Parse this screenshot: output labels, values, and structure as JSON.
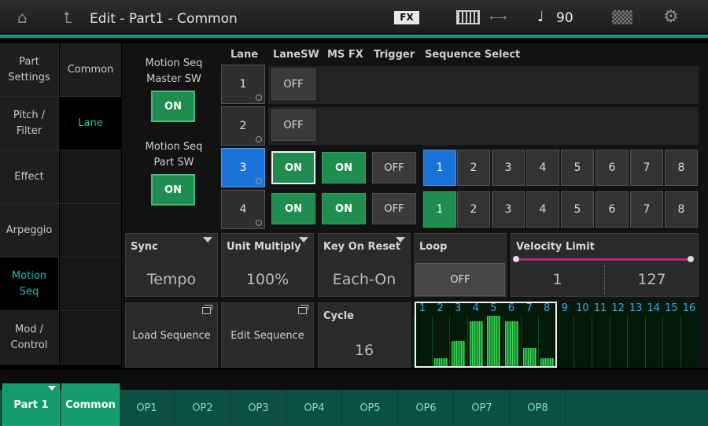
{
  "header": {
    "title": "Edit - Part1 - Common",
    "fx_badge": "FX",
    "tempo": "90"
  },
  "nav_primary": [
    {
      "label": "Part\nSettings",
      "active": false
    },
    {
      "label": "Pitch /\nFilter",
      "active": false
    },
    {
      "label": "Effect",
      "active": false
    },
    {
      "label": "Arpeggio",
      "active": false
    },
    {
      "label": "Motion\nSeq",
      "active": true
    },
    {
      "label": "Mod /\nControl",
      "active": false
    }
  ],
  "nav_secondary": [
    {
      "label": "Common",
      "active": false
    },
    {
      "label": "Lane",
      "active": true
    }
  ],
  "master_sw": {
    "label": "Motion Seq\nMaster SW",
    "value": "ON"
  },
  "part_sw": {
    "label": "Motion Seq\nPart SW",
    "value": "ON"
  },
  "columns": {
    "lane": "Lane",
    "lanesw": "LaneSW",
    "msfx": "MS FX",
    "trigger": "Trigger",
    "seq_select": "Sequence Select"
  },
  "lanes": [
    {
      "num": "1",
      "active": false,
      "lanesw": "OFF"
    },
    {
      "num": "2",
      "active": false,
      "lanesw": "OFF"
    },
    {
      "num": "3",
      "active": true,
      "lanesw": "ON",
      "msfx": "ON",
      "trigger": "OFF",
      "sequences": [
        "1",
        "2",
        "3",
        "4",
        "5",
        "6",
        "7",
        "8"
      ],
      "selected": "1",
      "color": "blue"
    },
    {
      "num": "4",
      "active": false,
      "lanesw": "ON",
      "msfx": "ON",
      "trigger": "OFF",
      "sequences": [
        "1",
        "2",
        "3",
        "4",
        "5",
        "6",
        "7",
        "8"
      ],
      "selected": "1",
      "color": "green"
    }
  ],
  "params": {
    "sync": {
      "label": "Sync",
      "value": "Tempo"
    },
    "unit_multiply": {
      "label": "Unit Multiply",
      "value": "100%"
    },
    "key_on_reset": {
      "label": "Key On Reset",
      "value": "Each-On"
    },
    "loop": {
      "label": "Loop",
      "value": "OFF"
    },
    "velocity_limit": {
      "label": "Velocity Limit",
      "min": "1",
      "max": "127"
    },
    "cycle": {
      "label": "Cycle",
      "value": "16"
    }
  },
  "actions": {
    "load": "Load Sequence",
    "edit": "Edit Sequence"
  },
  "steps": {
    "labels": [
      "1",
      "2",
      "3",
      "4",
      "5",
      "6",
      "7",
      "8",
      "9",
      "10",
      "11",
      "12",
      "13",
      "14",
      "15",
      "16"
    ],
    "levels": [
      0,
      0.18,
      0.52,
      0.9,
      1.0,
      0.9,
      0.38,
      0.18,
      0,
      0,
      0,
      0,
      0,
      0,
      0,
      0
    ],
    "cycle_length": 8
  },
  "bottom_tabs": {
    "part": "Part 1",
    "common": "Common",
    "ops": [
      "OP1",
      "OP2",
      "OP3",
      "OP4",
      "OP5",
      "OP6",
      "OP7",
      "OP8"
    ]
  },
  "colors": {
    "accent": "#12c2b0",
    "on_green": "#1f8d4f",
    "select_blue": "#1a73d9",
    "vel_bar": "#c0208c"
  }
}
